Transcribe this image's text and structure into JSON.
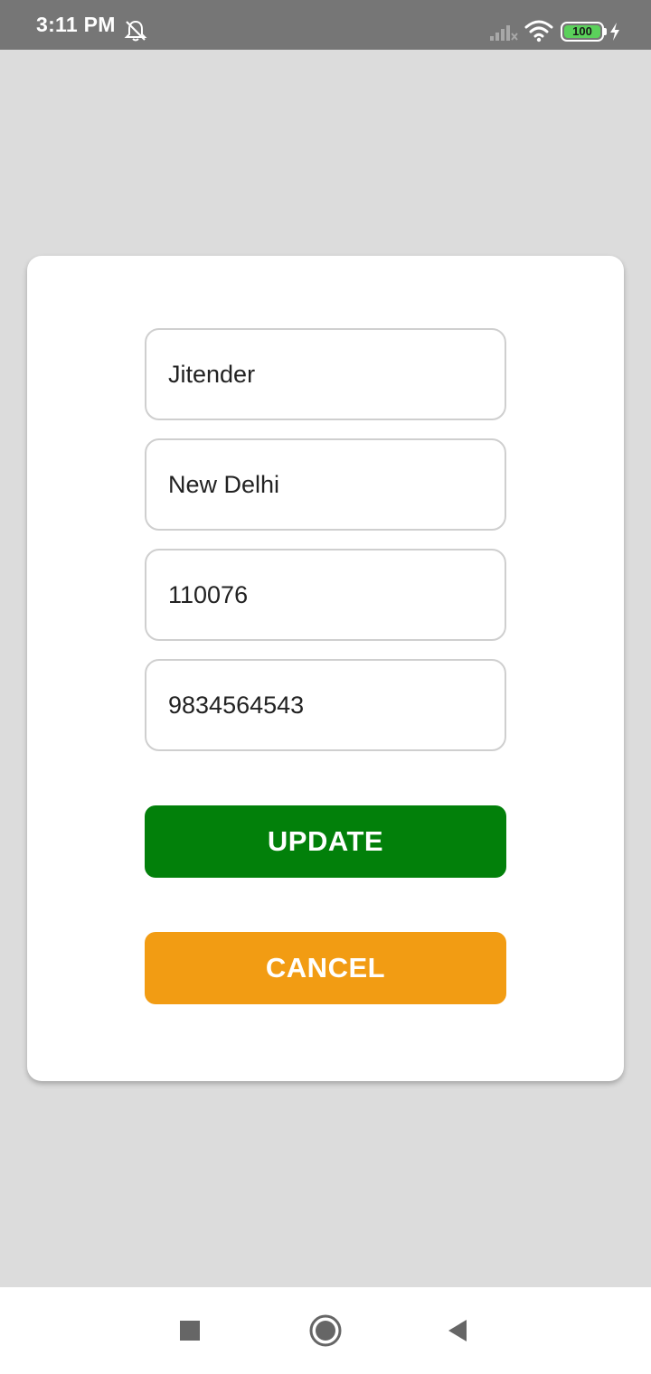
{
  "status_bar": {
    "time": "3:11 PM",
    "battery_level": "100",
    "icons": [
      "mute-bell-icon",
      "signal-icon",
      "wifi-icon",
      "battery-icon",
      "charging-icon"
    ]
  },
  "form": {
    "name_value": "Jitender",
    "city_value": "New Delhi",
    "pincode_value": "110076",
    "phone_value": "9834564543"
  },
  "buttons": {
    "update_label": "UPDATE",
    "cancel_label": "CANCEL"
  },
  "colors": {
    "update": "#02800a",
    "cancel": "#f29c13",
    "background": "#dcdcdc",
    "status_bar": "#767676"
  },
  "nav_bar": {
    "icons": [
      "recents-square-icon",
      "home-circle-icon",
      "back-triangle-icon"
    ]
  }
}
